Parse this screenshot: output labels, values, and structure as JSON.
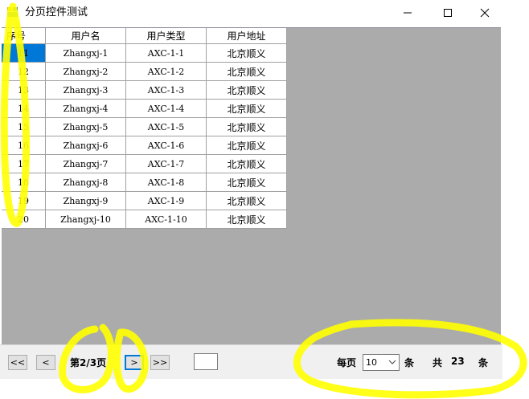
{
  "window": {
    "title": "分页控件测试"
  },
  "grid": {
    "columns": [
      "序号",
      "用户名",
      "用户类型",
      "用户地址"
    ],
    "rows": [
      [
        "11",
        "Zhangxj-1",
        "AXC-1-1",
        "北京顺义"
      ],
      [
        "12",
        "Zhangxj-2",
        "AXC-1-2",
        "北京顺义"
      ],
      [
        "13",
        "Zhangxj-3",
        "AXC-1-3",
        "北京顺义"
      ],
      [
        "14",
        "Zhangxj-4",
        "AXC-1-4",
        "北京顺义"
      ],
      [
        "15",
        "Zhangxj-5",
        "AXC-1-5",
        "北京顺义"
      ],
      [
        "16",
        "Zhangxj-6",
        "AXC-1-6",
        "北京顺义"
      ],
      [
        "17",
        "Zhangxj-7",
        "AXC-1-7",
        "北京顺义"
      ],
      [
        "18",
        "Zhangxj-8",
        "AXC-1-8",
        "北京顺义"
      ],
      [
        "19",
        "Zhangxj-9",
        "AXC-1-9",
        "北京顺义"
      ],
      [
        "20",
        "Zhangxj-10",
        "AXC-1-10",
        "北京顺义"
      ]
    ],
    "selected_cell": "11"
  },
  "pager": {
    "first_label": "<<",
    "prev_label": "<",
    "page_info": "第2/3页",
    "next_label": ">",
    "last_label": ">>",
    "jump_value": "",
    "per_page_label": "每页",
    "per_page_value": "10",
    "per_page_unit": "条",
    "total_label": "共",
    "total_value": "23",
    "total_unit": "条"
  },
  "colors": {
    "selection": "#0078d7",
    "grid_background": "#ababab",
    "highlight_annotation": "#ffff00"
  }
}
